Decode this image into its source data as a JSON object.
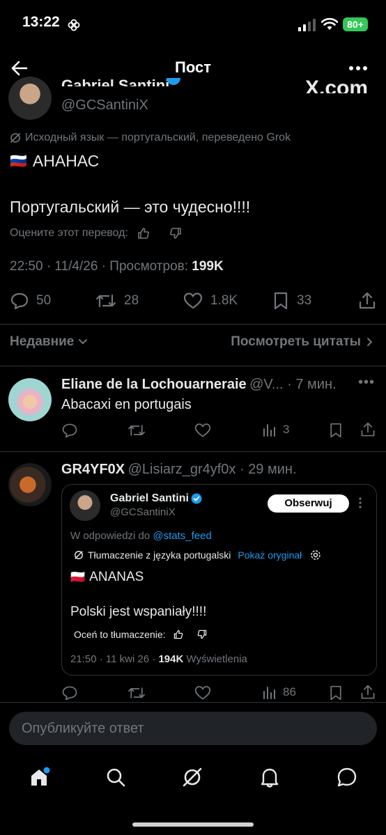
{
  "status": {
    "time": "13:22",
    "battery": "80+"
  },
  "header": {
    "title": "Пост"
  },
  "post": {
    "author_name": "Gabriel Santini",
    "handle": "@GCSantiniX",
    "watermark": "X.com",
    "translation_note": "Исходный язык — португальский, переведено Grok",
    "flag": "🇷🇺",
    "line1": "АНАНАС",
    "line2": "Португальский — это чудесно!!!!",
    "rate_label": "Оцените этот перевод:",
    "meta_time": "22:50 · 11/4/26 · Просмотров: ",
    "meta_views": "199K",
    "replies": "50",
    "reposts": "28",
    "likes": "1.8K",
    "bookmarks": "33"
  },
  "sort": {
    "label": "Недавние",
    "quotes_label": "Посмотреть цитаты"
  },
  "reply1": {
    "name": "Eliane de la Lochouarneraie",
    "meta": "@V... · 7 мин.",
    "text": "Abacaxi en portugais",
    "views": "3"
  },
  "reply2": {
    "name": "GR4YF0X",
    "meta": "@Lisiarz_gr4yf0x · 29 мин.",
    "views": "86",
    "quote": {
      "name": "Gabriel Santini",
      "handle": "@GCSantiniX",
      "follow": "Obserwuj",
      "reply_to_prefix": "W odpowiedzi do ",
      "reply_to_handle": "@stats_feed",
      "translation": "Tłumaczenie z języka portugalski",
      "show_original": "Pokaż oryginał",
      "flag": "🇵🇱",
      "line1": "ANANAS",
      "line2": "Polski jest wspaniały!!!!",
      "rate_label": "Oceń to tłumaczenie:",
      "meta_time": "21:50 · 11 kwi 26 · ",
      "meta_views": "194K",
      "meta_suffix": " Wyświetlenia"
    }
  },
  "reply_box": {
    "placeholder": "Опубликуйте ответ"
  },
  "colors": {
    "accent": "#1d9bf0",
    "background": "#000000",
    "text": "#e7e9ea",
    "muted": "#71767b"
  }
}
